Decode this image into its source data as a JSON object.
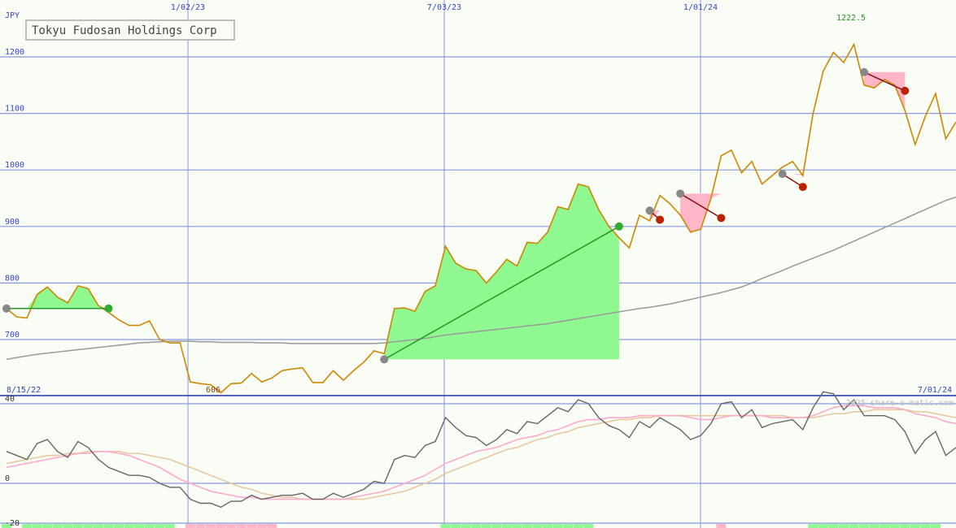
{
  "chart_data": [
    {
      "type": "line",
      "title": "Tokyu Fudosan Holdings Corp",
      "currency_label": "JPY",
      "ylim": [
        670,
        1235
      ],
      "ytick_labels": [
        "700",
        "800",
        "900",
        "1000",
        "1100",
        "1200"
      ],
      "ytick_values": [
        700,
        800,
        900,
        1000,
        1100,
        1200
      ],
      "xtick_labels": [
        "1/02/23",
        "7/03/23",
        "1/01/24"
      ],
      "start_date_label": "8/15/22",
      "end_date_label": "7/01/24",
      "high_label": "1222.5",
      "low_label": "606",
      "grid": true,
      "colors": {
        "price": "#cc8800",
        "ma": "#999999",
        "gain_fill": "#90f890",
        "loss_fill": "#ffb6c8",
        "gain_line": "#229922",
        "loss_line": "#881111",
        "grid": "#8899dd",
        "axis_text": "#3344cc",
        "high_text": "#229922",
        "low_text": "#884400"
      },
      "series": [
        {
          "values": [
            755,
            740,
            738,
            780,
            793,
            775,
            765,
            795,
            790,
            760,
            748,
            735,
            725,
            725,
            733,
            700,
            694,
            694,
            625,
            622,
            620,
            606,
            622,
            623,
            640,
            625,
            632,
            645,
            648,
            650,
            624,
            624,
            645,
            628,
            645,
            660,
            680,
            675,
            755,
            756,
            750,
            785,
            795,
            865,
            835,
            825,
            822,
            800,
            820,
            842,
            830,
            872,
            870,
            890,
            935,
            930,
            975,
            970,
            930,
            900,
            880,
            862,
            920,
            910,
            955,
            940,
            920,
            890,
            895,
            950,
            1025,
            1035,
            995,
            1015,
            975,
            990,
            1005,
            1015,
            990,
            1100,
            1175,
            1208,
            1190,
            1222,
            1150,
            1145,
            1160,
            1150,
            1105,
            1045,
            1095,
            1135,
            1055,
            1085
          ]
        },
        {
          "values": [
            665,
            668,
            671,
            674,
            676,
            678,
            680,
            682,
            684,
            686,
            688,
            690,
            692,
            694,
            695,
            696,
            697,
            697,
            697,
            696,
            696,
            695,
            695,
            695,
            695,
            694,
            694,
            694,
            693,
            693,
            693,
            693,
            693,
            693,
            693,
            693,
            693,
            694,
            696,
            698,
            700,
            702,
            705,
            708,
            710,
            712,
            714,
            716,
            718,
            720,
            722,
            724,
            726,
            728,
            731,
            734,
            737,
            740,
            743,
            746,
            749,
            752,
            755,
            757,
            760,
            763,
            767,
            771,
            775,
            779,
            783,
            788,
            793,
            800,
            808,
            815,
            822,
            830,
            837,
            844,
            851,
            858,
            866,
            874,
            882,
            890,
            898,
            906,
            914,
            922,
            930,
            938,
            946,
            952
          ]
        }
      ],
      "trades": [
        {
          "entry_index": 0,
          "entry_price": 755,
          "exit_index": 10,
          "exit_price": 755,
          "result": "gain"
        },
        {
          "entry_index": 37,
          "entry_price": 665,
          "exit_index": 60,
          "exit_price": 900,
          "result": "gain"
        },
        {
          "entry_index": 63,
          "entry_price": 928,
          "exit_index": 64,
          "exit_price": 912,
          "result": "loss"
        },
        {
          "entry_index": 66,
          "entry_price": 958,
          "exit_index": 70,
          "exit_price": 915,
          "result": "loss"
        },
        {
          "entry_index": 76,
          "entry_price": 993,
          "exit_index": 78,
          "exit_price": 970,
          "result": "loss"
        },
        {
          "entry_index": 84,
          "entry_price": 1173,
          "exit_index": 88,
          "exit_price": 1140,
          "result": "loss"
        }
      ]
    },
    {
      "type": "line",
      "ylim": [
        -20,
        43
      ],
      "ytick_labels": [
        "40",
        "0",
        "-20"
      ],
      "ytick_values": [
        40,
        0,
        -20
      ],
      "watermark": "2025 share-o-matic.com",
      "colors": {
        "main": "#666666",
        "signal": "#ffaacc",
        "slow": "#e8c8a0"
      },
      "series": [
        {
          "values": [
            16,
            14,
            12,
            20,
            22,
            16,
            13,
            21,
            18,
            12,
            8,
            6,
            4,
            4,
            3,
            0,
            -2,
            -2,
            -8,
            -10,
            -10,
            -12,
            -9,
            -9,
            -6,
            -8,
            -7,
            -6,
            -6,
            -5,
            -8,
            -8,
            -5,
            -7,
            -5,
            -3,
            1,
            0,
            12,
            14,
            13,
            19,
            21,
            33,
            28,
            24,
            23,
            19,
            22,
            27,
            25,
            31,
            30,
            34,
            38,
            36,
            42,
            40,
            33,
            29,
            27,
            23,
            31,
            28,
            33,
            30,
            27,
            22,
            24,
            30,
            40,
            41,
            33,
            37,
            28,
            30,
            31,
            32,
            27,
            38,
            46,
            45,
            37,
            42,
            34,
            34,
            34,
            32,
            26,
            15,
            22,
            26,
            14,
            18
          ]
        },
        {
          "values": [
            8,
            9,
            10,
            11,
            12,
            13,
            14,
            15,
            15,
            16,
            16,
            15,
            14,
            12,
            10,
            8,
            5,
            2,
            0,
            -2,
            -4,
            -5,
            -6,
            -7,
            -7,
            -8,
            -8,
            -8,
            -8,
            -8,
            -8,
            -8,
            -8,
            -8,
            -7,
            -6,
            -5,
            -4,
            -2,
            0,
            2,
            4,
            7,
            10,
            12,
            14,
            16,
            17,
            18,
            20,
            22,
            23,
            24,
            26,
            27,
            29,
            31,
            32,
            32,
            33,
            33,
            33,
            34,
            34,
            34,
            34,
            34,
            33,
            32,
            32,
            33,
            34,
            34,
            34,
            34,
            33,
            33,
            33,
            33,
            34,
            36,
            38,
            39,
            39,
            39,
            38,
            38,
            38,
            37,
            35,
            34,
            33,
            31,
            30
          ]
        },
        {
          "values": [
            10,
            11,
            12,
            13,
            14,
            14,
            15,
            15,
            16,
            16,
            16,
            16,
            15,
            15,
            14,
            13,
            12,
            10,
            8,
            6,
            4,
            2,
            0,
            -2,
            -3,
            -5,
            -6,
            -7,
            -7,
            -8,
            -8,
            -8,
            -8,
            -8,
            -8,
            -8,
            -7,
            -6,
            -5,
            -4,
            -2,
            0,
            2,
            5,
            7,
            9,
            11,
            13,
            15,
            17,
            18,
            20,
            22,
            23,
            25,
            26,
            28,
            29,
            30,
            31,
            32,
            32,
            33,
            33,
            34,
            34,
            34,
            34,
            34,
            34,
            34,
            34,
            34,
            34,
            34,
            34,
            34,
            33,
            33,
            33,
            34,
            35,
            35,
            36,
            36,
            37,
            37,
            37,
            37,
            36,
            36,
            35,
            34,
            33
          ]
        }
      ],
      "histogram_signs": [
        1,
        0,
        1,
        1,
        1,
        1,
        1,
        1,
        1,
        1,
        1,
        1,
        1,
        1,
        1,
        1,
        1,
        0,
        -1,
        -1,
        -1,
        -1,
        -1,
        -1,
        -1,
        -1,
        -1,
        0,
        0,
        0,
        0,
        0,
        0,
        0,
        0,
        0,
        0,
        0,
        0,
        0,
        0,
        0,
        0,
        1,
        1,
        1,
        1,
        1,
        1,
        1,
        1,
        1,
        1,
        1,
        1,
        1,
        1,
        1,
        0,
        0,
        0,
        0,
        0,
        0,
        0,
        0,
        0,
        0,
        0,
        0,
        -1,
        0,
        0,
        0,
        0,
        0,
        0,
        0,
        0,
        1,
        1,
        1,
        1,
        1,
        1,
        1,
        1,
        1,
        1,
        1,
        1,
        1,
        0,
        0
      ]
    }
  ]
}
